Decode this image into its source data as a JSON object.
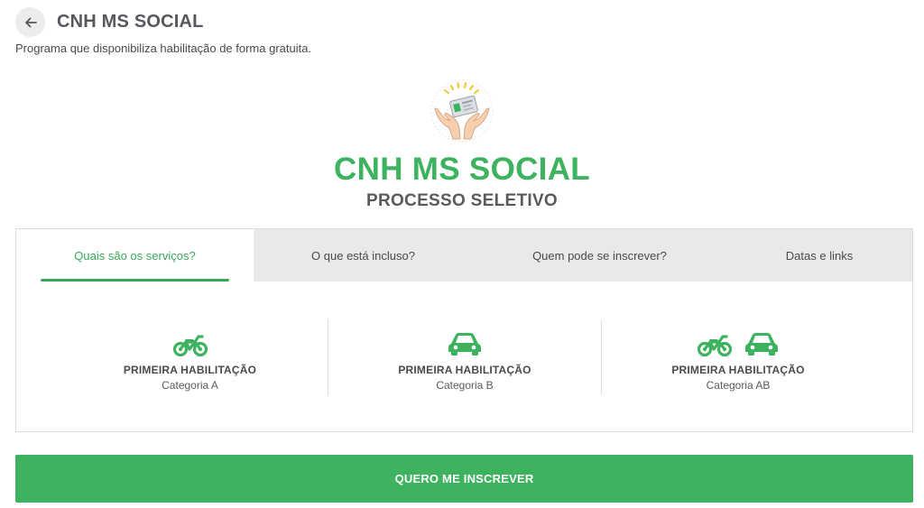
{
  "header": {
    "back_icon": "arrow-left-icon",
    "title": "CNH MS SOCIAL",
    "subtitle": "Programa que disponibiliza habilitação de forma gratuita."
  },
  "hero": {
    "logo_icon": "hands-holding-license-icon",
    "title": "CNH MS SOCIAL",
    "subtitle": "PROCESSO SELETIVO"
  },
  "tabs": [
    {
      "label": "Quais são os serviços?",
      "active": true
    },
    {
      "label": "O que está incluso?",
      "active": false
    },
    {
      "label": "Quem pode se inscrever?",
      "active": false
    },
    {
      "label": "Datas e links",
      "active": false
    }
  ],
  "services": [
    {
      "icons": [
        "motorcycle-icon"
      ],
      "name": "PRIMEIRA HABILITAÇÃO",
      "category": "Categoria A"
    },
    {
      "icons": [
        "car-icon"
      ],
      "name": "PRIMEIRA HABILITAÇÃO",
      "category": "Categoria B"
    },
    {
      "icons": [
        "motorcycle-icon",
        "car-icon"
      ],
      "name": "PRIMEIRA HABILITAÇÃO",
      "category": "Categoria AB"
    }
  ],
  "cta": {
    "label": "QUERO ME INSCREVER"
  },
  "colors": {
    "accent": "#3db35f",
    "tab_inactive_bg": "#e8e9eb",
    "text": "#4a4a4a"
  }
}
